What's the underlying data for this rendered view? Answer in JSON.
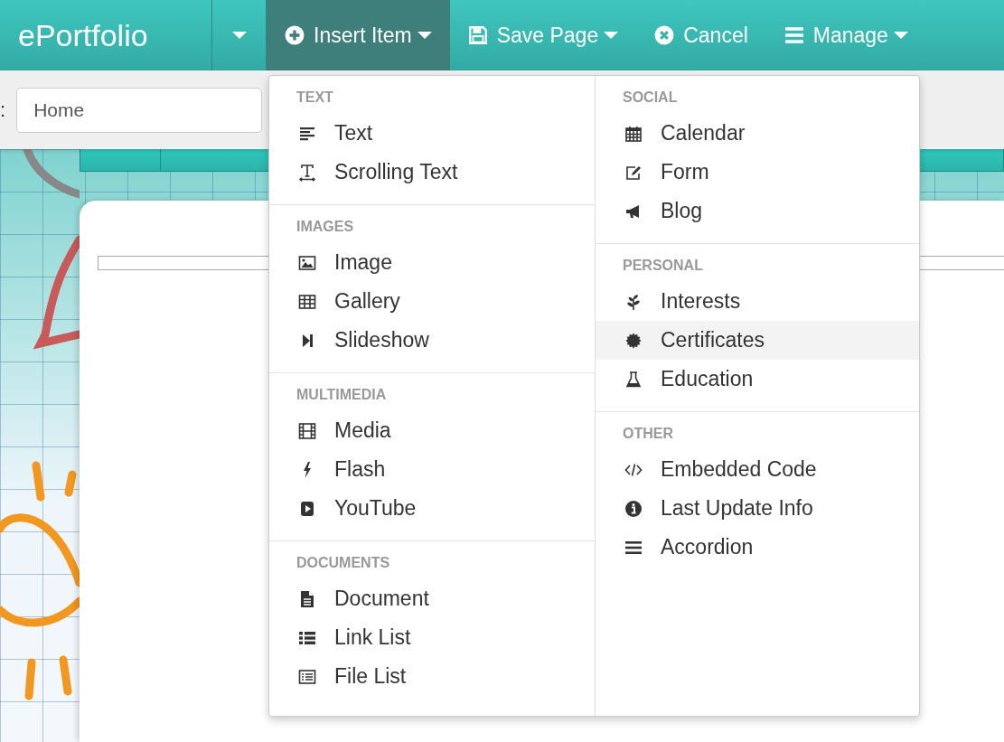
{
  "app": {
    "brand": "ePortfolio"
  },
  "nav": [
    {
      "kind": "toggle",
      "caret": true,
      "selected": false
    },
    {
      "kind": "insert",
      "label": "Insert Item",
      "caret": true,
      "selected": true
    },
    {
      "kind": "save",
      "label": "Save Page",
      "caret": true,
      "selected": false
    },
    {
      "kind": "cancel",
      "label": "Cancel",
      "caret": false,
      "selected": false
    },
    {
      "kind": "manage",
      "label": "Manage",
      "caret": true,
      "selected": false
    }
  ],
  "toolbar": {
    "label": ":",
    "page_field": {
      "value": "Home"
    }
  },
  "insert_menu": {
    "columns": [
      [
        {
          "heading": "TEXT",
          "items": [
            {
              "label": "Text",
              "kind": "text",
              "selected": false
            },
            {
              "label": "Scrolling Text",
              "kind": "scrolling-text",
              "selected": false
            }
          ]
        },
        {
          "heading": "IMAGES",
          "items": [
            {
              "label": "Image",
              "kind": "image",
              "selected": false
            },
            {
              "label": "Gallery",
              "kind": "gallery",
              "selected": false
            },
            {
              "label": "Slideshow",
              "kind": "slideshow",
              "selected": false
            }
          ]
        },
        {
          "heading": "MULTIMEDIA",
          "items": [
            {
              "label": "Media",
              "kind": "media",
              "selected": false
            },
            {
              "label": "Flash",
              "kind": "flash",
              "selected": false
            },
            {
              "label": "YouTube",
              "kind": "youtube",
              "selected": false
            }
          ]
        },
        {
          "heading": "DOCUMENTS",
          "items": [
            {
              "label": "Document",
              "kind": "document",
              "selected": false
            },
            {
              "label": "Link List",
              "kind": "link-list",
              "selected": false
            },
            {
              "label": "File List",
              "kind": "file-list",
              "selected": false
            }
          ]
        }
      ],
      [
        {
          "heading": "SOCIAL",
          "items": [
            {
              "label": "Calendar",
              "kind": "calendar",
              "selected": false
            },
            {
              "label": "Form",
              "kind": "form",
              "selected": false
            },
            {
              "label": "Blog",
              "kind": "blog",
              "selected": false
            }
          ]
        },
        {
          "heading": "PERSONAL",
          "items": [
            {
              "label": "Interests",
              "kind": "interests",
              "selected": false
            },
            {
              "label": "Certificates",
              "kind": "certificates",
              "selected": true
            },
            {
              "label": "Education",
              "kind": "education",
              "selected": false
            }
          ]
        },
        {
          "heading": "OTHER",
          "items": [
            {
              "label": "Embedded Code",
              "kind": "code",
              "selected": false
            },
            {
              "label": "Last Update Info",
              "kind": "info",
              "selected": false
            },
            {
              "label": "Accordion",
              "kind": "accordion",
              "selected": false
            }
          ]
        }
      ]
    ]
  }
}
